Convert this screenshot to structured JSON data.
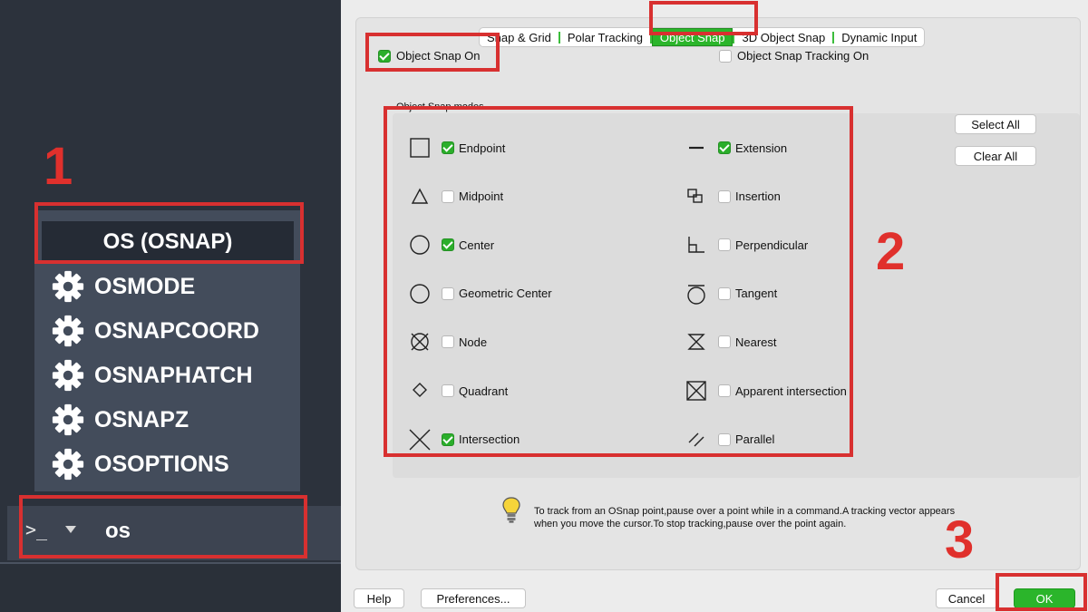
{
  "command_line": {
    "autocomplete": {
      "selected": "OS (OSNAP)",
      "items": [
        "OSMODE",
        "OSNAPCOORD",
        "OSNAPHATCH",
        "OSNAPZ",
        "OSOPTIONS"
      ]
    },
    "prompt": ">_",
    "typed": "os"
  },
  "steps": [
    "1",
    "2",
    "3"
  ],
  "dialog": {
    "tabs": [
      {
        "label": "Snap & Grid",
        "active": false
      },
      {
        "label": "Polar Tracking",
        "active": false
      },
      {
        "label": "Object Snap",
        "active": true
      },
      {
        "label": "3D Object Snap",
        "active": false
      },
      {
        "label": "Dynamic Input",
        "active": false
      }
    ],
    "object_snap_on": {
      "label": "Object Snap On",
      "checked": true
    },
    "object_snap_tracking_on": {
      "label": "Object Snap Tracking On",
      "checked": false
    },
    "modes_label": "Object Snap modes",
    "modes_left": [
      {
        "label": "Endpoint",
        "checked": true,
        "icon": "endpoint-icon"
      },
      {
        "label": "Midpoint",
        "checked": false,
        "icon": "midpoint-icon"
      },
      {
        "label": "Center",
        "checked": true,
        "icon": "center-icon"
      },
      {
        "label": "Geometric Center",
        "checked": false,
        "icon": "geometric-center-icon"
      },
      {
        "label": "Node",
        "checked": false,
        "icon": "node-icon"
      },
      {
        "label": "Quadrant",
        "checked": false,
        "icon": "quadrant-icon"
      },
      {
        "label": "Intersection",
        "checked": true,
        "icon": "intersection-icon"
      }
    ],
    "modes_right": [
      {
        "label": "Extension",
        "checked": true,
        "icon": "extension-icon"
      },
      {
        "label": "Insertion",
        "checked": false,
        "icon": "insertion-icon"
      },
      {
        "label": "Perpendicular",
        "checked": false,
        "icon": "perpendicular-icon"
      },
      {
        "label": "Tangent",
        "checked": false,
        "icon": "tangent-icon"
      },
      {
        "label": "Nearest",
        "checked": false,
        "icon": "nearest-icon"
      },
      {
        "label": "Apparent intersection",
        "checked": false,
        "icon": "apparent-intersection-icon"
      },
      {
        "label": "Parallel",
        "checked": false,
        "icon": "parallel-icon"
      }
    ],
    "select_all": "Select All",
    "clear_all": "Clear All",
    "tip": "To track from an OSnap point,pause over a point while in a command.A tracking vector appears when you move the cursor.To stop tracking,pause over the point again.",
    "buttons": {
      "help": "Help",
      "preferences": "Preferences...",
      "cancel": "Cancel",
      "ok": "OK"
    }
  },
  "colors": {
    "accent_green": "#2bb52b",
    "highlight_red": "#d83030",
    "dark_panel": "#2c323c"
  }
}
